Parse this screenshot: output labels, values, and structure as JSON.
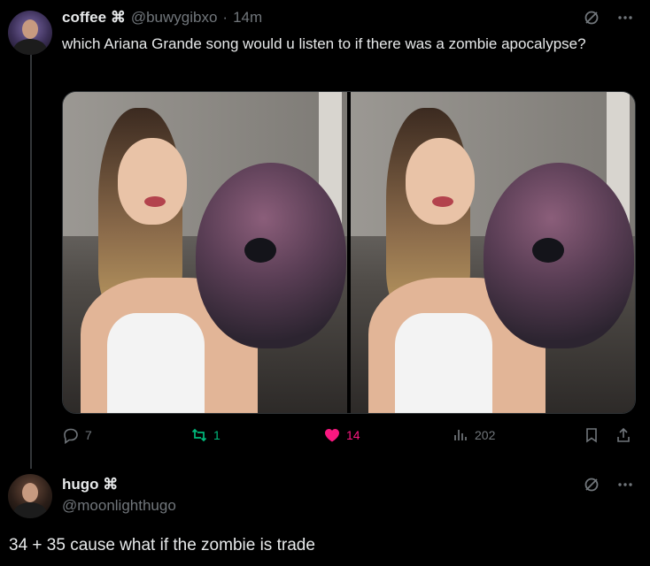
{
  "tweet": {
    "display_name": "coffee",
    "name_badge": "⌘",
    "handle": "@buwygibxo",
    "separator": "·",
    "time": "14m",
    "text": "which Ariana Grande song would u listen to if there was a zombie apocalypse?",
    "stats": {
      "replies": "7",
      "retweets": "1",
      "likes": "14",
      "views": "202"
    }
  },
  "reply": {
    "display_name": "hugo",
    "name_badge": "⌘",
    "handle": "@moonlighthugo",
    "text": "34 + 35 cause what if the zombie is trade"
  },
  "colors": {
    "background": "#000000",
    "text_primary": "#e7e9ea",
    "text_secondary": "#71767b",
    "retweet_active": "#00ba7c",
    "like_active": "#f91880"
  },
  "icons": {
    "more": "more-icon",
    "grok": "grok-icon",
    "reply": "reply-icon",
    "retweet": "retweet-icon",
    "like": "heart-icon",
    "views": "views-icon",
    "bookmark": "bookmark-icon",
    "share": "share-icon"
  }
}
